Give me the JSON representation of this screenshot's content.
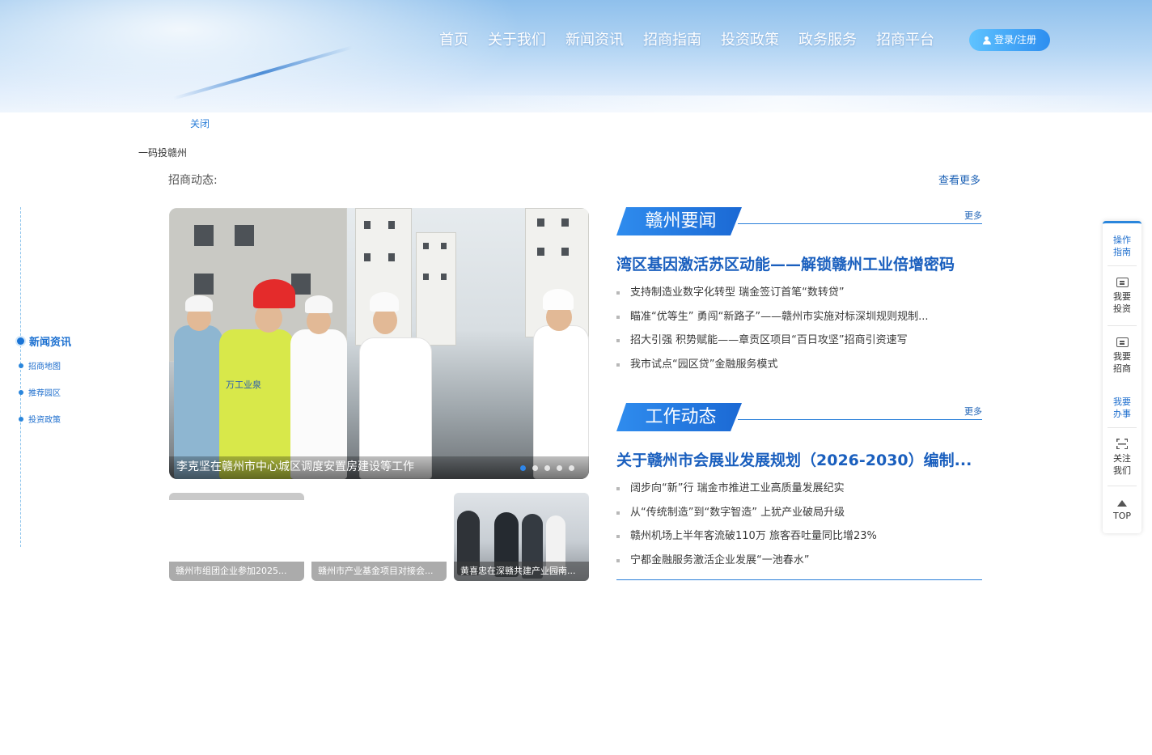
{
  "header": {
    "nav": [
      "首页",
      "关于我们",
      "新闻资讯",
      "招商指南",
      "投资政策",
      "政务服务",
      "招商平台"
    ],
    "login_label": "登录/注册"
  },
  "popup": {
    "close_label": "关闭",
    "qr_label": "一码投赣州"
  },
  "section": {
    "title": "招商动态:",
    "view_more": "查看更多"
  },
  "left_nav": {
    "items": [
      {
        "label": "新闻资讯",
        "active": true
      },
      {
        "label": "招商地图"
      },
      {
        "label": "推荐园区"
      },
      {
        "label": "投资政策"
      }
    ]
  },
  "carousel": {
    "caption": "李克坚在赣州市中心城区调度安置房建设等工作",
    "slide_count": 5,
    "active_index": 0,
    "vest_text": "万工业泉"
  },
  "thumbnails": [
    {
      "caption": "赣州市组团企业参加2025..."
    },
    {
      "caption": "赣州市产业基金项目对接会..."
    },
    {
      "caption": "黄喜忠在深赣共建产业园南..."
    }
  ],
  "news_ganzhou": {
    "tab_title": "赣州要闻",
    "more": "更多",
    "headline": "湾区基因激活苏区动能——解锁赣州工业倍增密码",
    "items": [
      "支持制造业数字化转型 瑞金签订首笔“数转贷”",
      "瞄准“优等生” 勇闯“新路子”——赣州市实施对标深圳规则规制...",
      "招大引强 积势赋能——章贡区项目“百日攻坚”招商引资速写",
      "我市试点“园区贷”金融服务模式"
    ]
  },
  "news_work": {
    "tab_title": "工作动态",
    "more": "更多",
    "headline": "关于赣州市会展业发展规划（2026-2030）编制...",
    "items": [
      "阔步向“新”行 瑞金市推进工业高质量发展纪实",
      "从“传统制造”到“数字智造” 上犹产业破局升级",
      "赣州机场上半年客流破110万 旅客吞吐量同比增23%",
      "宁都金融服务激活企业发展“一池春水”"
    ]
  },
  "side_tool": {
    "guide": [
      "操作",
      "指南"
    ],
    "invest": [
      "我要",
      "投资"
    ],
    "recruit": [
      "我要",
      "招商"
    ],
    "handle": [
      "我要",
      "办事"
    ],
    "follow": [
      "关注",
      "我们"
    ],
    "top": "TOP"
  },
  "colors": {
    "brand_blue": "#1a5fbe",
    "accent_blue": "#2a86dc",
    "login_gradient_start": "#5fc3ff",
    "login_gradient_end": "#2d8ef0"
  }
}
